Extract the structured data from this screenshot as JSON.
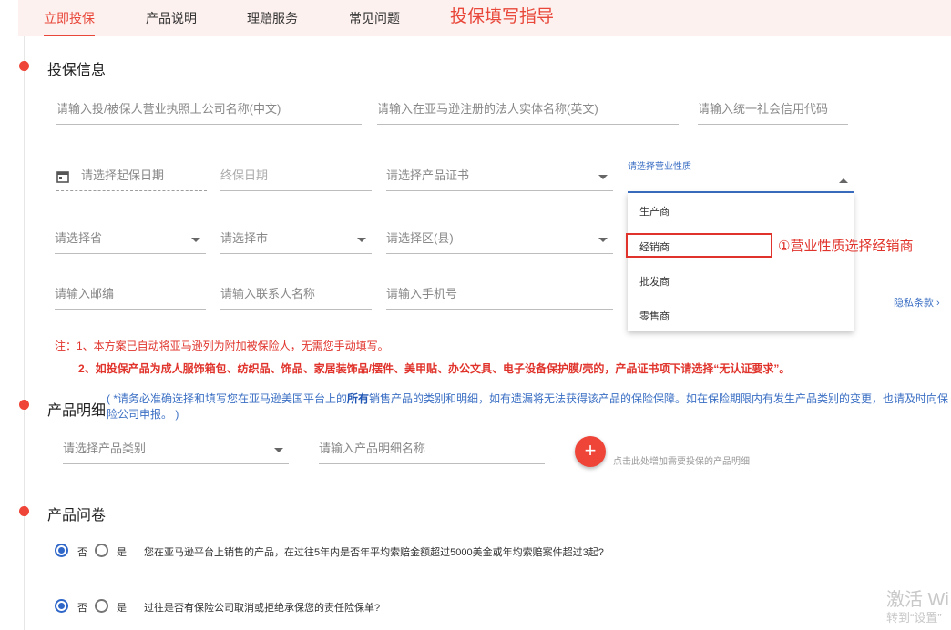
{
  "tabs": [
    {
      "label": "立即投保",
      "active": true
    },
    {
      "label": "产品说明"
    },
    {
      "label": "理赔服务"
    },
    {
      "label": "常见问题"
    },
    {
      "label": "投保填写指导"
    }
  ],
  "sections": {
    "insure_info": "投保信息",
    "product_detail": "产品明细",
    "questionnaire": "产品问卷"
  },
  "fields": {
    "company_cn": "请输入投/被保人营业执照上公司名称(中文)",
    "company_en": "请输入在亚马逊注册的法人实体名称(英文)",
    "credit_code": "请输入统一社会信用代码",
    "start_date": "请选择起保日期",
    "end_date": "终保日期",
    "certificate": "请选择产品证书",
    "business_type_label": "请选择营业性质",
    "province": "请选择省",
    "city": "请选择市",
    "district": "请选择区(县)",
    "postcode": "请输入邮编",
    "contact": "请输入联系人名称",
    "phone": "请输入手机号",
    "product_category": "请选择产品类别",
    "product_name": "请输入产品明细名称"
  },
  "dropdown": {
    "options": [
      "生产商",
      "经销商",
      "批发商",
      "零售商"
    ]
  },
  "annotation": "①营业性质选择经销商",
  "privacy_link": "隐私条款 ›",
  "notes": {
    "line1": "注：1、本方案已自动将亚马逊列为附加被保险人，无需您手动填写。",
    "line2": "2、如投保产品为成人服饰箱包、纺织品、饰品、家居装饰品/摆件、美甲贴、办公文具、电子设备保护膜/壳的，产品证书项下请选择“无认证要求”。"
  },
  "product_desc": {
    "part1": "( *请务必准确选择和填写您在亚马逊美国平台上的",
    "bold": "所有",
    "part2": "销售产品的类别和明细，如有遗漏将无法获得该产品的保险保障。如在保险期限内有发生产品类别的变更，也请及时向保险公司申报。 )"
  },
  "add_hint": "点击此处增加需要投保的产品明细",
  "plus_symbol": "+",
  "questions": [
    {
      "no": "否",
      "yes": "是",
      "text": "您在亚马逊平台上销售的产品，在过往5年内是否年平均索赔金额超过5000美金或年均索赔案件超过3起?"
    },
    {
      "no": "否",
      "yes": "是",
      "text": "过往是否有保险公司取消或拒绝承保您的责任险保单?"
    }
  ],
  "watermark": {
    "line1": "激活 Wi",
    "line2": "转到“设置”"
  },
  "colors": {
    "accent": "#e8473a",
    "blue": "#3b6fc4"
  }
}
